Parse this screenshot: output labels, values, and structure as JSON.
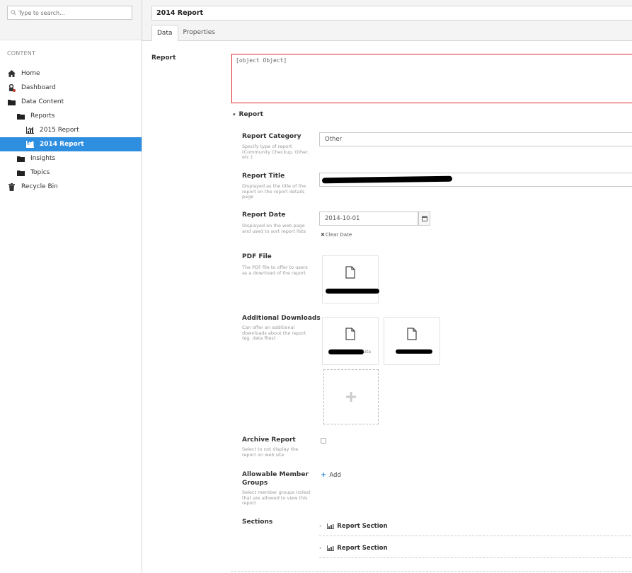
{
  "search": {
    "placeholder": "Type to search..."
  },
  "sidebar": {
    "section_title": "CONTENT",
    "items": [
      {
        "label": "Home",
        "icon": "home-icon"
      },
      {
        "label": "Dashboard",
        "icon": "dashboard-icon"
      },
      {
        "label": "Data Content",
        "icon": "folder-icon"
      },
      {
        "label": "Reports",
        "icon": "folder-icon"
      },
      {
        "label": "2015 Report",
        "icon": "report-icon"
      },
      {
        "label": "2014 Report",
        "icon": "report-icon",
        "active": true
      },
      {
        "label": "Insights",
        "icon": "folder-icon"
      },
      {
        "label": "Topics",
        "icon": "folder-icon"
      },
      {
        "label": "Recycle Bin",
        "icon": "trash-icon"
      }
    ]
  },
  "header": {
    "title": "2014 Report",
    "tabs": [
      {
        "label": "Data",
        "active": true
      },
      {
        "label": "Properties"
      }
    ]
  },
  "report": {
    "label": "Report",
    "value": "[object Object]",
    "section_label": "Report"
  },
  "fields": {
    "category": {
      "label": "Report Category",
      "desc": "Specify type of report (Community Checkup, Other, etc.)",
      "value": "Other"
    },
    "title": {
      "label": "Report Title",
      "desc": "Displayed as the title of the report on the report details page",
      "value": ""
    },
    "date": {
      "label": "Report Date",
      "desc": "Displayed on the web page and used to sort report lists",
      "value": "2014-10-01",
      "clear_label": "Clear Date"
    },
    "pdf": {
      "label": "PDF File",
      "desc": "The PDF file to offer to users as a download of the report"
    },
    "downloads": {
      "label": "Additional Downloads",
      "desc": "Can offer an additional downloads about the report (eg. data files)",
      "file1_name": "data"
    },
    "archive": {
      "label": "Archive Report",
      "desc": "Select to not display the report on web site"
    },
    "groups": {
      "label": "Allowable Member Groups",
      "desc": "Select member groups (roles) that are allowed to view this report",
      "add_label": "Add"
    },
    "sections": {
      "label": "Sections",
      "items": [
        "Report Section",
        "Report Section"
      ]
    }
  },
  "colors": {
    "accent": "#2e8ee0",
    "error_border": "#dd2a2a"
  }
}
